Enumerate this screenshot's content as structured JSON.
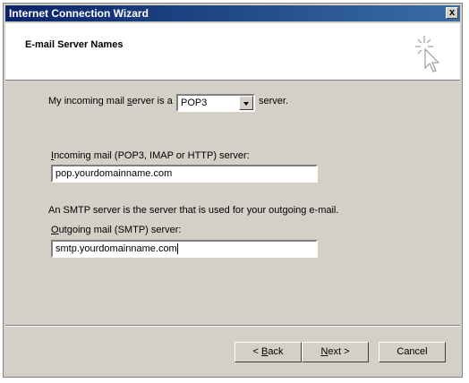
{
  "window": {
    "title": "Internet Connection Wizard",
    "close_label": "x"
  },
  "header": {
    "title": "E-mail Server Names",
    "icon": "wizard-sparkle-cursor-icon"
  },
  "incoming_type": {
    "label_prefix": "My incoming mail ",
    "label_underlined": "s",
    "label_suffix": "erver is a",
    "selected": "POP3",
    "after_label": "server."
  },
  "incoming_server": {
    "label_underlined": "I",
    "label_rest": "ncoming mail (POP3, IMAP or HTTP) server:",
    "value": "pop.yourdomainname.com"
  },
  "smtp_note": "An SMTP server is the server that is used for your outgoing e-mail.",
  "outgoing_server": {
    "label_underlined": "O",
    "label_rest": "utgoing mail (SMTP) server:",
    "value": "smtp.yourdomainname.com"
  },
  "buttons": {
    "back_prefix": "< ",
    "back_underlined": "B",
    "back_rest": "ack",
    "next_underlined": "N",
    "next_rest": "ext >",
    "cancel": "Cancel"
  },
  "colors": {
    "titlebar_start": "#0a246a",
    "titlebar_end": "#3a6ea5",
    "dialog_bg": "#d4d0c8"
  }
}
